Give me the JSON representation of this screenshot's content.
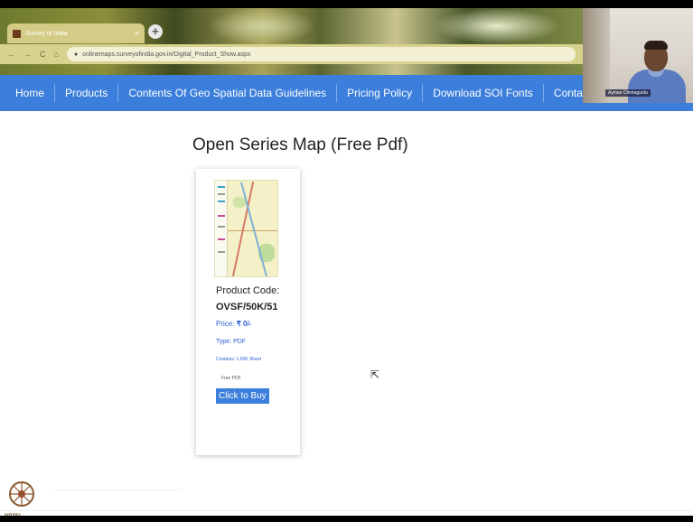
{
  "browser": {
    "tab_title": "Survey of India",
    "tab_close": "×",
    "new_tab": "+",
    "back": "←",
    "forward": "→",
    "reload": "C",
    "home": "⌂",
    "url": "onlinemaps.surveyofindia.gov.in/Digital_Product_Show.aspx"
  },
  "navbar": {
    "items": [
      "Home",
      "Products",
      "Contents Of Geo Spatial Data Guidelines",
      "Pricing Policy",
      "Download SOI Fonts",
      "Contact Us"
    ],
    "user_icon": "person-icon"
  },
  "webcam": {
    "name_tag": "Ayman Chintagunta"
  },
  "main": {
    "title": "Open Series Map (Free Pdf)",
    "product": {
      "code_label": "Product Code:",
      "code": "OVSF/50K/51",
      "price_label": "Price:",
      "price": "₹ 0/-",
      "type": "Type: PDF",
      "contains": "Contains: 1,50K Sheet",
      "free": "Free PDF",
      "buy_button": "Click to Buy"
    }
  },
  "footer": {
    "logo_text": "NPTEL"
  },
  "colors": {
    "navbar": "#3b7edb",
    "button": "#3b7edb",
    "link_text": "#2c5fd0"
  }
}
